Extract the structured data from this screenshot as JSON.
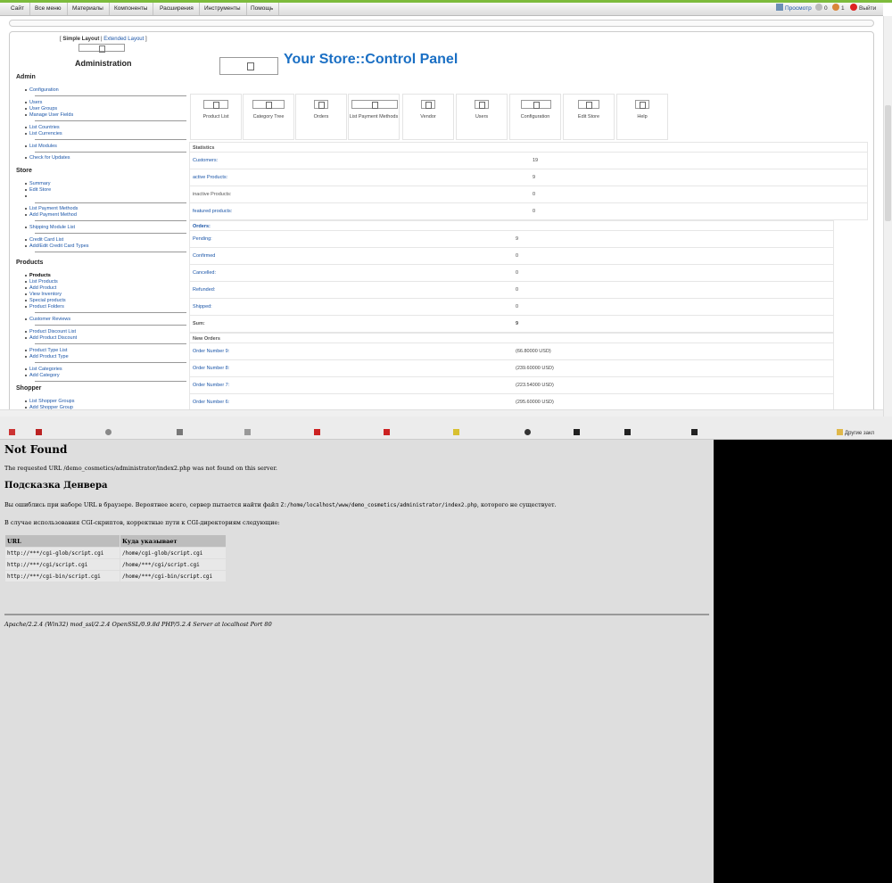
{
  "topmenu": {
    "items": [
      "Сайт",
      "Все меню",
      "Материалы",
      "Компоненты",
      "Расширения",
      "Инструменты",
      "Помощь"
    ],
    "preview": "Просмотр",
    "messages": "0",
    "users": "1",
    "logout": "Выйти"
  },
  "layout": {
    "simple": "Simple Layout",
    "extended": "Extended Layout",
    "open": "[",
    "sep": "|",
    "close": "]"
  },
  "admin_title": "Administration",
  "cp_title": "Your Store::Control Panel",
  "sidebar": {
    "admin": {
      "title": "Admin",
      "items": [
        "Configuration",
        "Users",
        "User Groups",
        "Manage User Fields",
        "List Countries",
        "List Currencies",
        "List Modules",
        "Check for Updates"
      ]
    },
    "store": {
      "title": "Store",
      "items": [
        "Summary",
        "Edit Store",
        "List Payment Methods",
        "Add Payment Method",
        "Shipping Module List",
        "Credit Card List",
        "Add/Edit Credit Card Types"
      ]
    },
    "products": {
      "title": "Products",
      "items": [
        "Products",
        "List Products",
        "Add Product",
        "View Inventory",
        "Special products",
        "Product Folders",
        "Customer Reviews",
        "Product Discount List",
        "Add Product Discount",
        "Product Type List",
        "Add Product Type",
        "List Categories",
        "Add Category"
      ]
    },
    "shopper": {
      "title": "Shopper",
      "items": [
        "List Shopper Groups",
        "Add Shopper Group"
      ]
    }
  },
  "quickicons": [
    "Product List",
    "Category Tree",
    "Orders",
    "List Payment Methods",
    "Vendor",
    "Users",
    "Configuration",
    "Edit Store",
    "Help"
  ],
  "statistics": {
    "title": "Statistics",
    "rows": [
      {
        "label": "Customers:",
        "value": "19"
      },
      {
        "label": "active Products:",
        "value": "9"
      },
      {
        "label": "inactive Products:",
        "value": "0"
      },
      {
        "label": "featured products:",
        "value": "0"
      }
    ]
  },
  "orders": {
    "title": "Orders:",
    "rows": [
      {
        "label": "Pending:",
        "value": "9"
      },
      {
        "label": "Confirmed",
        "value": "0"
      },
      {
        "label": "Cancelled:",
        "value": "0"
      },
      {
        "label": "Refunded:",
        "value": "0"
      },
      {
        "label": "Shipped:",
        "value": "0"
      },
      {
        "label": "Sum:",
        "value": "9"
      }
    ]
  },
  "new_orders": {
    "title": "New Orders",
    "rows": [
      {
        "label": "Order Number 9:",
        "value": "(66.80000 USD)"
      },
      {
        "label": "Order Number 8:",
        "value": "(239.60000 USD)"
      },
      {
        "label": "Order Number 7:",
        "value": "(223.54000 USD)"
      },
      {
        "label": "Order Number 6:",
        "value": "(295.60000 USD)"
      }
    ]
  },
  "bookmarks": {
    "right": "Другие закл"
  },
  "error_page": {
    "title": "Not Found",
    "message": "The requested URL /demo_cosmetics/administrator/index2.php was not found on this server.",
    "hint_title": "Подсказка Денвера",
    "hint_prefix": "Вы ошиблись при наборе URL в браузере. Вероятнее всего, сервер пытается найти файл",
    "hint_path": "Z:/home/localhost/www/demo_cosmetics/administrator/index2.php",
    "hint_suffix": ", которого не существует.",
    "cgi_text": "В случае использования CGI-скриптов, корректные пути к CGI-директориям следующие:",
    "table_headers": [
      "URL",
      "Куда указывает"
    ],
    "table_rows": [
      [
        "http://***/cgi-glob/script.cgi",
        "/home/cgi-glob/script.cgi"
      ],
      [
        "http://***/cgi/script.cgi",
        "/home/***/cgi/script.cgi"
      ],
      [
        "http://***/cgi-bin/script.cgi",
        "/home/***/cgi-bin/script.cgi"
      ]
    ],
    "server_signature": "Apache/2.2.4 (Win32) mod_ssl/2.2.4 OpenSSL/0.9.8d PHP/5.2.4 Server at localhost Port 80"
  },
  "colors": {
    "accent_green": "#7dbb3c",
    "link_blue": "#1a55a8",
    "title_blue": "#1a6fc4",
    "error_bg": "#dedede"
  }
}
